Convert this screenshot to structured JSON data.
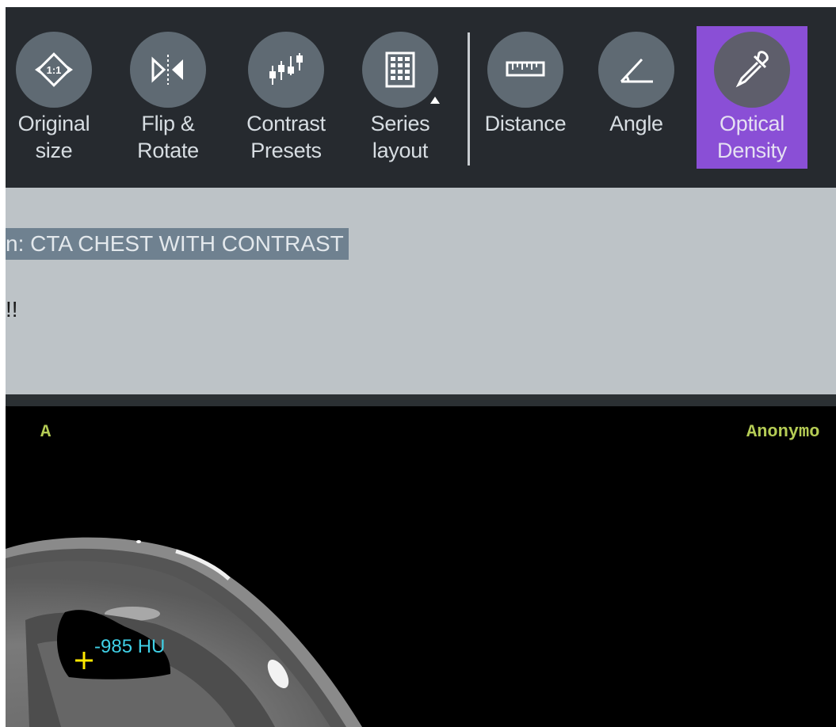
{
  "toolbar": {
    "tools": [
      {
        "label": "Original\nsize",
        "icon": "original-size-icon"
      },
      {
        "label": "Flip &\nRotate",
        "icon": "flip-rotate-icon"
      },
      {
        "label": "Contrast\nPresets",
        "icon": "contrast-presets-icon"
      },
      {
        "label": "Series\nlayout",
        "icon": "series-layout-icon"
      },
      {
        "label": "Distance",
        "icon": "ruler-icon"
      },
      {
        "label": "Angle",
        "icon": "angle-icon"
      },
      {
        "label": "Optical\nDensity",
        "icon": "eyedropper-icon"
      }
    ],
    "active_tool": "Optical Density",
    "accent_color": "#8a4fd6"
  },
  "info": {
    "study_line": "n: CTA CHEST WITH CONTRAST",
    "note": "!!"
  },
  "viewport": {
    "orientation_marker": "A",
    "patient_name": "Anonymo",
    "measurement": "-985 HU",
    "overlay_color": "#b5cc55",
    "measurement_color": "#3fd0e6"
  }
}
